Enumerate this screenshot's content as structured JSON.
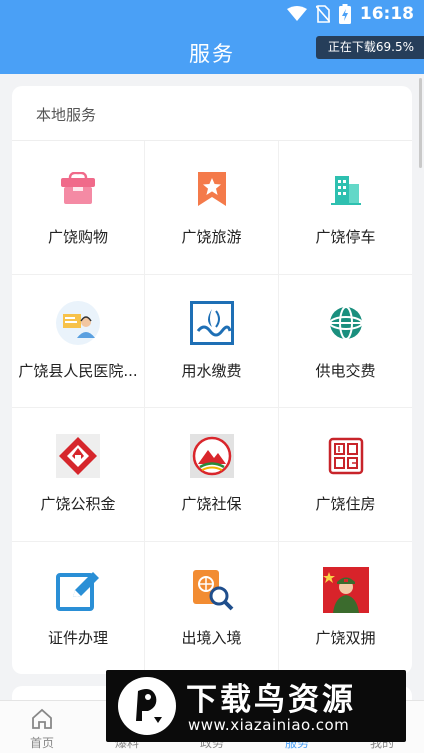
{
  "status": {
    "time": "16:18"
  },
  "header": {
    "title": "服务",
    "download_badge": "正在下载69.5%"
  },
  "local_services": {
    "title": "本地服务",
    "items": [
      {
        "label": "广饶购物",
        "icon": "shopping-bag-icon"
      },
      {
        "label": "广饶旅游",
        "icon": "bookmark-star-icon"
      },
      {
        "label": "广饶停车",
        "icon": "building-icon"
      },
      {
        "label": "广饶县人民医院...",
        "icon": "hospital-doctor-icon"
      },
      {
        "label": "用水缴费",
        "icon": "water-logo-icon"
      },
      {
        "label": "供电交费",
        "icon": "power-grid-logo-icon"
      },
      {
        "label": "广饶公积金",
        "icon": "housing-fund-logo-icon"
      },
      {
        "label": "广饶社保",
        "icon": "social-security-logo-icon"
      },
      {
        "label": "广饶住房",
        "icon": "housing-seal-icon"
      },
      {
        "label": "证件办理",
        "icon": "edit-document-icon"
      },
      {
        "label": "出境入境",
        "icon": "passport-search-icon"
      },
      {
        "label": "广饶双拥",
        "icon": "soldier-flag-icon"
      }
    ]
  },
  "tabbar": {
    "tabs": [
      {
        "label": "首页",
        "icon": "home-icon"
      },
      {
        "label": "爆料",
        "icon": "megaphone-icon"
      },
      {
        "label": "政务",
        "icon": "government-icon"
      },
      {
        "label": "服务",
        "icon": "services-icon",
        "active": true
      },
      {
        "label": "我的",
        "icon": "user-icon"
      }
    ]
  },
  "watermark": {
    "title": "下载鸟资源",
    "url": "www.xiazainiao.com"
  },
  "colors": {
    "accent": "#4aa0f6",
    "background": "#f2f3f5"
  }
}
